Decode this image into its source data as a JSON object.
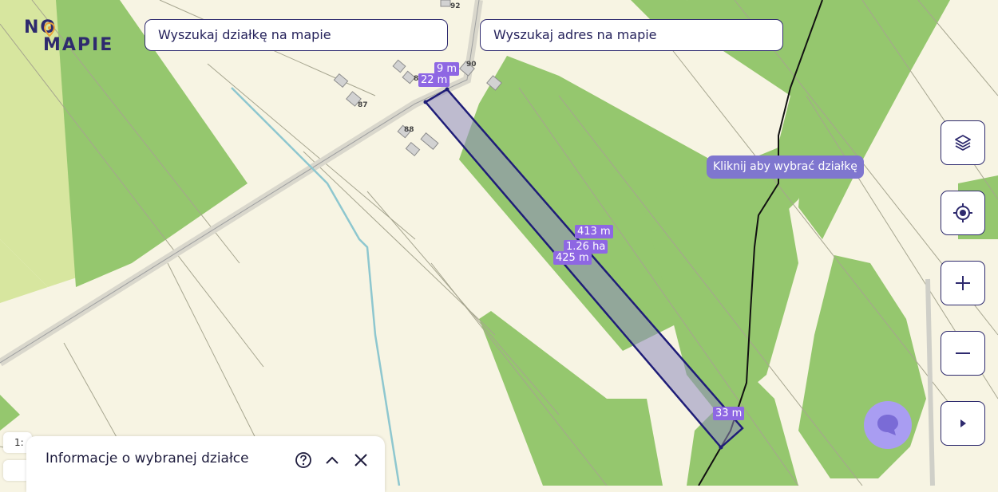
{
  "app": {
    "logo_line1": "NO",
    "logo_line2": "MAPIE"
  },
  "search": {
    "plot_placeholder": "Wyszukaj działkę na mapie",
    "address_placeholder": "Wyszukaj adres na mapie"
  },
  "map": {
    "tooltip": "Kliknij aby wybrać działkę",
    "house_numbers": [
      "92",
      "90",
      "87",
      "88",
      "8"
    ],
    "measurements": {
      "top_edge": "9 m",
      "top_left_edge": "22 m",
      "long_edge_right": "413 m",
      "area": "1.26 ha",
      "long_edge_left": "425 m",
      "bottom_edge": "33 m"
    },
    "colors": {
      "background": "#f7f4e3",
      "forest": "#95c76e",
      "light_field": "#d7e69f",
      "plot_outline": "#1f1d78",
      "plot_fill": "#8f8cbf",
      "label": "#8e67e3"
    }
  },
  "controls": {
    "layers_icon": "layers-icon",
    "locate_icon": "crosshair-icon",
    "zoom_in_icon": "plus-icon",
    "zoom_out_icon": "minus-icon",
    "expand_icon": "play-icon"
  },
  "scale": {
    "value": "1:"
  },
  "panel": {
    "title": "Informacje o wybranej działce"
  }
}
